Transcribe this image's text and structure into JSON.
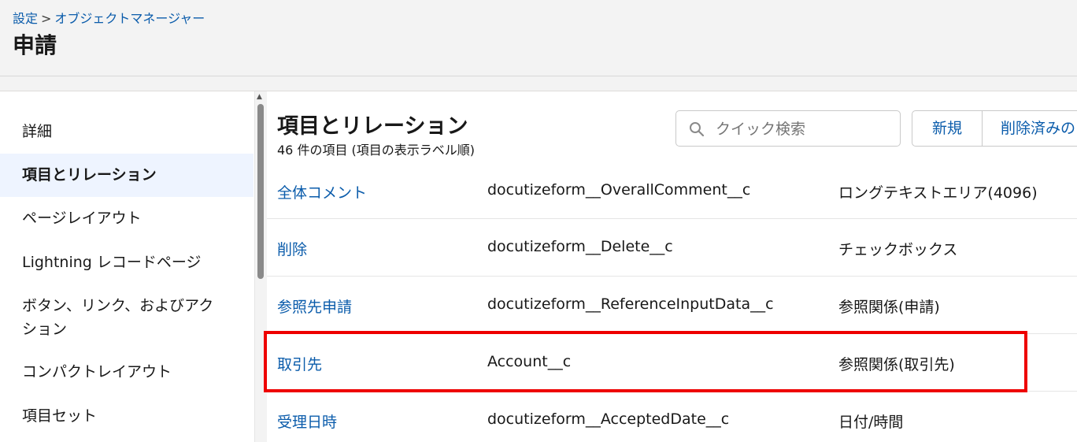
{
  "header": {
    "breadcrumb": [
      {
        "label": "設定"
      },
      {
        "label": "オブジェクトマネージャー"
      }
    ],
    "breadcrumb_separator": ">",
    "title": "申請"
  },
  "sidebar": {
    "items": [
      {
        "label": "詳細",
        "active": false
      },
      {
        "label": "項目とリレーション",
        "active": true
      },
      {
        "label": "ページレイアウト",
        "active": false
      },
      {
        "label": "Lightning レコードページ",
        "active": false
      },
      {
        "label": "ボタン、リンク、およびアク",
        "label2": "ション",
        "active": false
      },
      {
        "label": "コンパクトレイアウト",
        "active": false
      },
      {
        "label": "項目セット",
        "active": false
      }
    ]
  },
  "main": {
    "section_title": "項目とリレーション",
    "section_subtitle": "46 件の項目 (項目の表示ラベル順)",
    "search_placeholder": "クイック検索",
    "buttons": {
      "new": "新規",
      "deleted": "削除済みの"
    },
    "rows": [
      {
        "label": "全体コメント",
        "api_name": "docutizeform__OverallComment__c",
        "type": "ロングテキストエリア(4096)"
      },
      {
        "label": "削除",
        "api_name": "docutizeform__Delete__c",
        "type": "チェックボックス"
      },
      {
        "label": "参照先申請",
        "api_name": "docutizeform__ReferenceInputData__c",
        "type": "参照関係(申請)"
      },
      {
        "label": "取引先",
        "api_name": "Account__c",
        "type": "参照関係(取引先)",
        "highlighted": true
      },
      {
        "label": "受理日時",
        "api_name": "docutizeform__AcceptedDate__c",
        "type": "日付/時間"
      }
    ]
  },
  "colors": {
    "link": "#0b5cab",
    "highlight": "#ee0000",
    "active_bg": "#eef4ff",
    "header_bg": "#f3f3f3"
  },
  "icons": {
    "search": "search-icon"
  }
}
